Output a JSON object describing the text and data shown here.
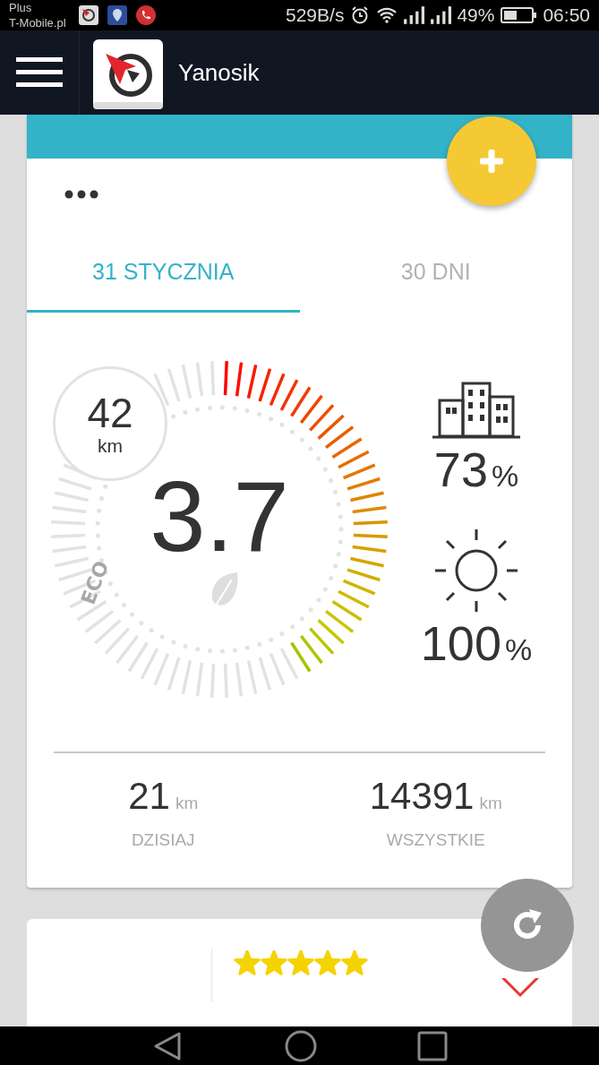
{
  "status_bar": {
    "carrier": [
      "Plus",
      "T-Mobile.pl"
    ],
    "speed": "529B/s",
    "battery": "49%",
    "time": "06:50"
  },
  "app_bar": {
    "title": "Yanosik"
  },
  "card": {
    "tabs": [
      {
        "label": "31 STYCZNIA",
        "selected": true
      },
      {
        "label": "30 DNI",
        "selected": false
      }
    ],
    "gauge": {
      "value": "3.7",
      "label": "ECO",
      "distance": "42",
      "distance_unit": "km"
    },
    "city": {
      "value": "73",
      "unit": "%"
    },
    "daylight": {
      "value": "100",
      "unit": "%"
    },
    "stats": [
      {
        "value": "21",
        "unit": "km",
        "label": "DZISIAJ"
      },
      {
        "value": "14391",
        "unit": "km",
        "label": "WSZYSTKIE"
      }
    ]
  },
  "rating_card": {
    "stars": 5
  }
}
